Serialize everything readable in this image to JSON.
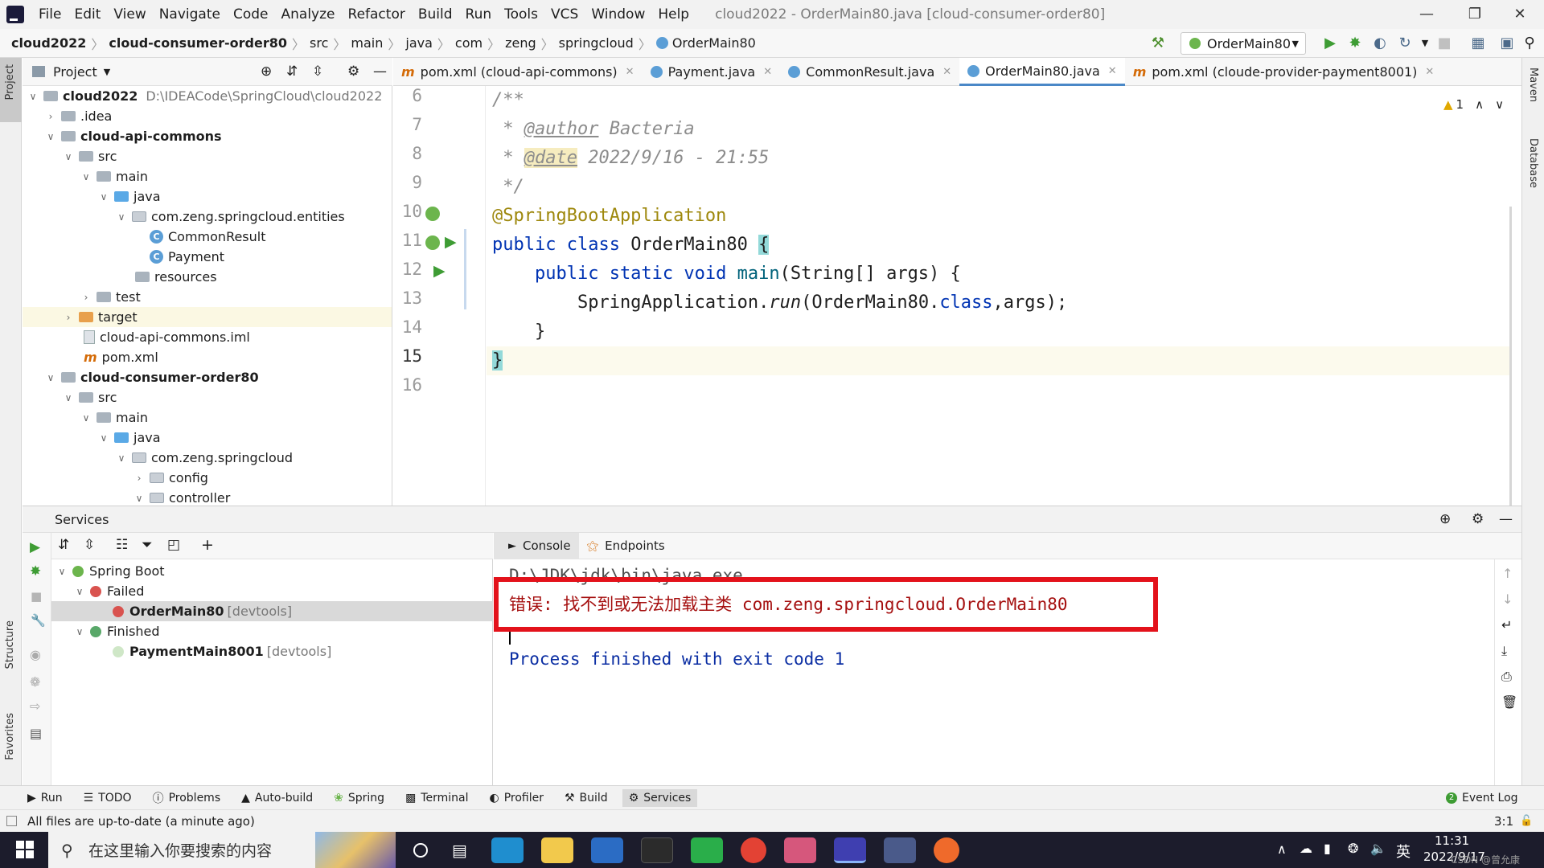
{
  "menu": {
    "items": [
      "File",
      "Edit",
      "View",
      "Navigate",
      "Code",
      "Analyze",
      "Refactor",
      "Build",
      "Run",
      "Tools",
      "VCS",
      "Window",
      "Help"
    ],
    "window_title": "cloud2022 - OrderMain80.java [cloud-consumer-order80]"
  },
  "breadcrumb": [
    "cloud2022",
    "cloud-consumer-order80",
    "src",
    "main",
    "java",
    "com",
    "zeng",
    "springcloud",
    "OrderMain80"
  ],
  "run_config": "OrderMain80",
  "project_panel": {
    "title": "Project",
    "tree": [
      {
        "label": "cloud2022",
        "hint": "D:\\IDEACode\\SpringCloud\\cloud2022",
        "bold": true
      },
      {
        "label": ".idea"
      },
      {
        "label": "cloud-api-commons",
        "bold": true
      },
      {
        "label": "src"
      },
      {
        "label": "main"
      },
      {
        "label": "java"
      },
      {
        "label": "com.zeng.springcloud.entities"
      },
      {
        "label": "CommonResult"
      },
      {
        "label": "Payment"
      },
      {
        "label": "resources"
      },
      {
        "label": "test"
      },
      {
        "label": "target"
      },
      {
        "label": "cloud-api-commons.iml"
      },
      {
        "label": "pom.xml"
      },
      {
        "label": "cloud-consumer-order80",
        "bold": true
      },
      {
        "label": "src"
      },
      {
        "label": "main"
      },
      {
        "label": "java"
      },
      {
        "label": "com.zeng.springcloud"
      },
      {
        "label": "config"
      },
      {
        "label": "controller"
      }
    ]
  },
  "editor": {
    "tabs": [
      "pom.xml (cloud-api-commons)",
      "Payment.java",
      "CommonResult.java",
      "OrderMain80.java",
      "pom.xml (cloude-provider-payment8001)"
    ],
    "active_tab": "OrderMain80.java",
    "warnings": "1",
    "line_numbers": [
      "6",
      "7",
      "8",
      "9",
      "10",
      "11",
      "12",
      "13",
      "14",
      "15",
      "16"
    ],
    "code": {
      "l6": "/**",
      "l7_star": " * ",
      "l7_tag": "@author",
      "l7_text": " Bacteria",
      "l8_star": " * ",
      "l8_tag": "@date",
      "l8_text": " 2022/9/16 - 21:55",
      "l9": " */",
      "l10": "@SpringBootApplication",
      "l11_kw": "public class ",
      "l11_name": "OrderMain80 ",
      "l11_brace": "{",
      "l12_kw": "    public static void ",
      "l12_fn": "main",
      "l12_rest": "(String[] args) {",
      "l13_a": "        SpringApplication.",
      "l13_fn": "run",
      "l13_b": "(OrderMain80.",
      "l13_kw": "class",
      "l13_c": ",args);",
      "l14": "    }",
      "l15": "}"
    }
  },
  "services": {
    "title": "Services",
    "tree": {
      "root": "Spring Boot",
      "failed": "Failed",
      "failed_app": "OrderMain80",
      "failed_app_hint": "[devtools]",
      "finished": "Finished",
      "finished_app": "PaymentMain8001",
      "finished_app_hint": "[devtools]"
    },
    "console_tabs": [
      "Console",
      "Endpoints"
    ],
    "console": {
      "line1": "D:\\JDK\\jdk\\bin\\java.exe ...",
      "error": "错误: 找不到或无法加载主类 com.zeng.springcloud.OrderMain80",
      "exit": "Process finished with exit code 1"
    }
  },
  "left_strip": {
    "project": "Project",
    "structure": "Structure",
    "favorites": "Favorites"
  },
  "right_strip": {
    "maven": "Maven",
    "database": "Database"
  },
  "tool_windows": [
    "Run",
    "TODO",
    "Problems",
    "Auto-build",
    "Spring",
    "Terminal",
    "Profiler",
    "Build",
    "Services"
  ],
  "event_log": "Event Log",
  "status": {
    "message": "All files are up-to-date (a minute ago)",
    "position": "3:1"
  },
  "taskbar": {
    "search_placeholder": "在这里输入你要搜索的内容",
    "ime": "英",
    "time": "11:31",
    "date": "2022/9/17",
    "watermark": "CSDN @曾允康"
  },
  "colors": {
    "accent": "#4a88c7",
    "error_box": "#e3121b",
    "error_text": "#a50f0f",
    "console_text": "#0b2ea3"
  }
}
